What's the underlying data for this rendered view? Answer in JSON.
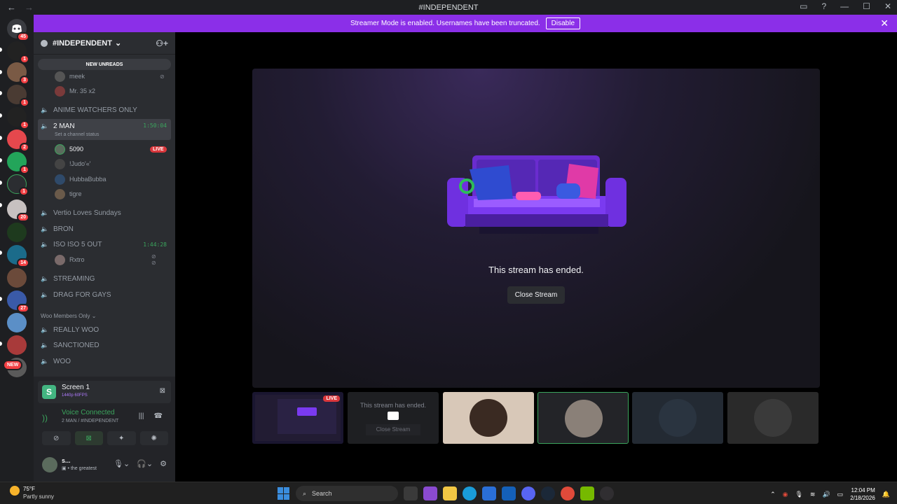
{
  "window": {
    "title": "#INDEPENDENT"
  },
  "banner": {
    "text": "Streamer Mode is enabled. Usernames have been truncated.",
    "button": "Disable"
  },
  "servers": {
    "home_badge": "45",
    "badges": [
      "1",
      "3",
      "1",
      "1",
      "2",
      "1",
      "1",
      "20",
      "14",
      "27",
      "NEW"
    ]
  },
  "sidebar": {
    "server_name": "#INDEPENDENT",
    "new_unreads": "NEW UNREADS",
    "top_users": [
      "meek",
      "Mr. 35 x2"
    ],
    "channels": {
      "anime": "ANIME WATCHERS ONLY",
      "two_man": "2 MAN",
      "two_man_timer": "1:50:04",
      "two_man_status": "Set a channel status",
      "vertio": "Vertio Loves Sundays",
      "bron": "BRON",
      "iso": "ISO ISO 5 OUT",
      "iso_timer": "1:44:28",
      "streaming": "STREAMING",
      "drag": "DRAG FOR GAYS",
      "really": "REALLY WOO",
      "sanctioned": "SANCTIONED",
      "woo": "WOO"
    },
    "two_man_users": [
      "5090",
      "!Judo'«'",
      "HubbaBubba",
      "tigre"
    ],
    "live_label": "LIVE",
    "iso_user": "Rxtro",
    "category": "Woo Members Only"
  },
  "panel": {
    "screen_title": "Screen 1",
    "screen_quality": "1440p 60FPS",
    "voice_status": "Voice Connected",
    "voice_channel": "2 MAN / #INDEPENDENT",
    "user_name": "s...",
    "user_status": "the greatest"
  },
  "stage": {
    "ended_message": "This stream has ended.",
    "close_button": "Close Stream",
    "tile_live": "LIVE",
    "tile_ended": "This stream has ended.",
    "tile_close": "Close Stream"
  },
  "taskbar": {
    "temperature": "75°F",
    "condition": "Partly sunny",
    "search": "Search",
    "time": "12:04 PM",
    "date": "2/18/2026"
  }
}
